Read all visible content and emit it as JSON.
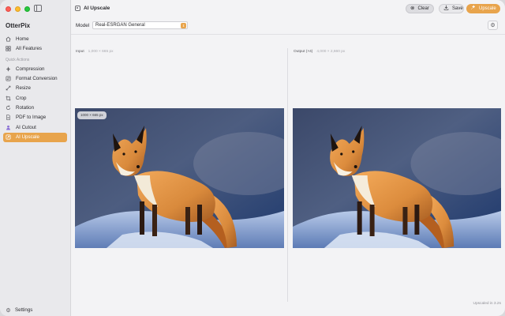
{
  "app": {
    "name": "OtterPix"
  },
  "sidebar": {
    "items": [
      {
        "label": "Home",
        "icon": "house-icon"
      },
      {
        "label": "All Features",
        "icon": "grid-icon"
      }
    ],
    "section_label": "Quick Actions",
    "quick_actions": [
      {
        "label": "Compression",
        "icon": "compress-icon"
      },
      {
        "label": "Format Conversion",
        "icon": "convert-icon"
      },
      {
        "label": "Resize",
        "icon": "resize-icon"
      },
      {
        "label": "Crop",
        "icon": "crop-icon"
      },
      {
        "label": "Rotation",
        "icon": "rotate-icon"
      },
      {
        "label": "PDF to Image",
        "icon": "document-icon"
      },
      {
        "label": "AI Cutout",
        "icon": "person-icon"
      },
      {
        "label": "AI Upscale",
        "icon": "upscale-icon",
        "active": true
      }
    ],
    "settings_label": "Settings"
  },
  "toolbar": {
    "title": "AI Upscale",
    "clear_label": "Clear",
    "save_label": "Save",
    "upscale_label": "Upscale"
  },
  "model": {
    "label": "Model",
    "selected": "Real-ESRGAN General"
  },
  "panels": {
    "input_label": "Input",
    "input_size": "1,000 × 665 px",
    "output_label": "Output (×4)",
    "output_size": "4,000 × 2,660 px",
    "badge": "1000 × 665 px"
  },
  "status": {
    "footer": "Upscaled in 3.2s"
  },
  "colors": {
    "accent": "#e8a44c",
    "sidebar_bg": "#e9e9ec",
    "window_bg": "#f3f3f5"
  }
}
